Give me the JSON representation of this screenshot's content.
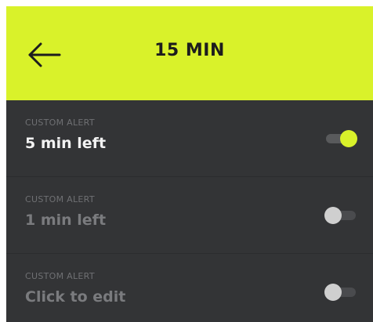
{
  "header": {
    "title": "15 MIN",
    "back_icon": "arrow-left-icon"
  },
  "alerts": [
    {
      "label": "CUSTOM ALERT",
      "value": "5 min left",
      "enabled": true
    },
    {
      "label": "CUSTOM ALERT",
      "value": "1 min left",
      "enabled": false
    },
    {
      "label": "CUSTOM ALERT",
      "value": "Click to edit",
      "enabled": false
    }
  ],
  "colors": {
    "accent": "#d9f22a",
    "background": "#333436",
    "toggle_off": "#cfcfcf"
  }
}
